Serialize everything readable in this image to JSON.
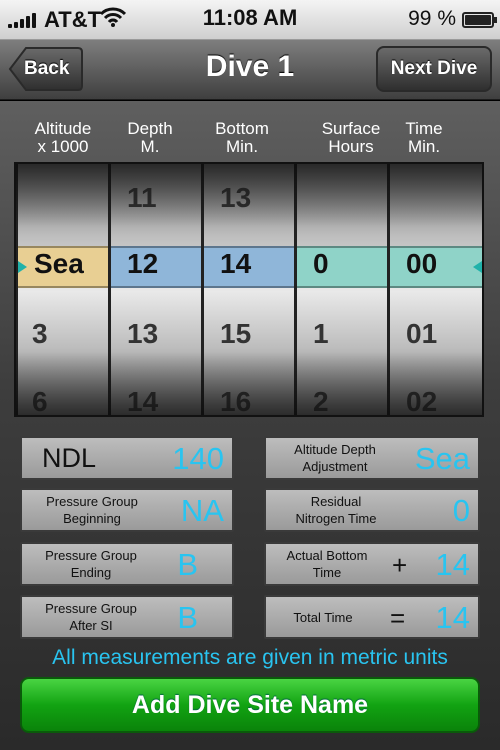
{
  "status_bar": {
    "carrier": "AT&T",
    "time": "11:08 AM",
    "battery": "99 %",
    "battery_level": 0.99,
    "signal_bars": 5,
    "wifi_icon": "wifi-icon"
  },
  "nav": {
    "title": "Dive 1",
    "back_label": "Back",
    "next_label": "Next Dive"
  },
  "picker": {
    "columns": [
      {
        "header": "Altitude\nx 1000",
        "above": [
          ""
        ],
        "selected": "Sea",
        "below": [
          "3",
          "6"
        ]
      },
      {
        "header": "Depth\nM.",
        "above": [
          "11"
        ],
        "selected": "12",
        "below": [
          "13",
          "14"
        ]
      },
      {
        "header": "Bottom\nMin.",
        "above": [
          "13"
        ],
        "selected": "14",
        "below": [
          "15",
          "16"
        ]
      },
      {
        "header": "Surface\nHours",
        "above": [
          ""
        ],
        "selected": "0",
        "below": [
          "1",
          "2"
        ]
      },
      {
        "header": "Time\nMin.",
        "above": [
          ""
        ],
        "selected": "00",
        "below": [
          "01",
          "02"
        ]
      }
    ],
    "selection_colors": {
      "altitude": "#e8cf93",
      "depth": "#8fb6d9",
      "bottom": "#8fb6d9",
      "surface": "#8fd3c8",
      "time": "#8fd3c8"
    }
  },
  "info": {
    "ndl": {
      "label": "NDL",
      "value": "140"
    },
    "altitude_adj": {
      "label": "Altitude Depth\nAdjustment",
      "value": "Sea"
    },
    "pg_beginning": {
      "label": "Pressure Group\nBeginning",
      "value": "NA"
    },
    "residual_nitrogen": {
      "label": "Residual\nNitrogen Time",
      "value": "0"
    },
    "pg_ending": {
      "label": "Pressure Group\nEnding",
      "value": "B"
    },
    "actual_bottom": {
      "label": "Actual Bottom\nTime",
      "operator": "+",
      "value": "14"
    },
    "pg_after_si": {
      "label": "Pressure Group\nAfter SI",
      "value": "B"
    },
    "total_time": {
      "label": "Total Time",
      "operator": "=",
      "value": "14"
    }
  },
  "metric_note": "All measurements are given in metric units",
  "add_site_label": "Add Dive Site Name",
  "colors": {
    "value_blue": "#29c4f0",
    "button_green": "#12a312"
  }
}
